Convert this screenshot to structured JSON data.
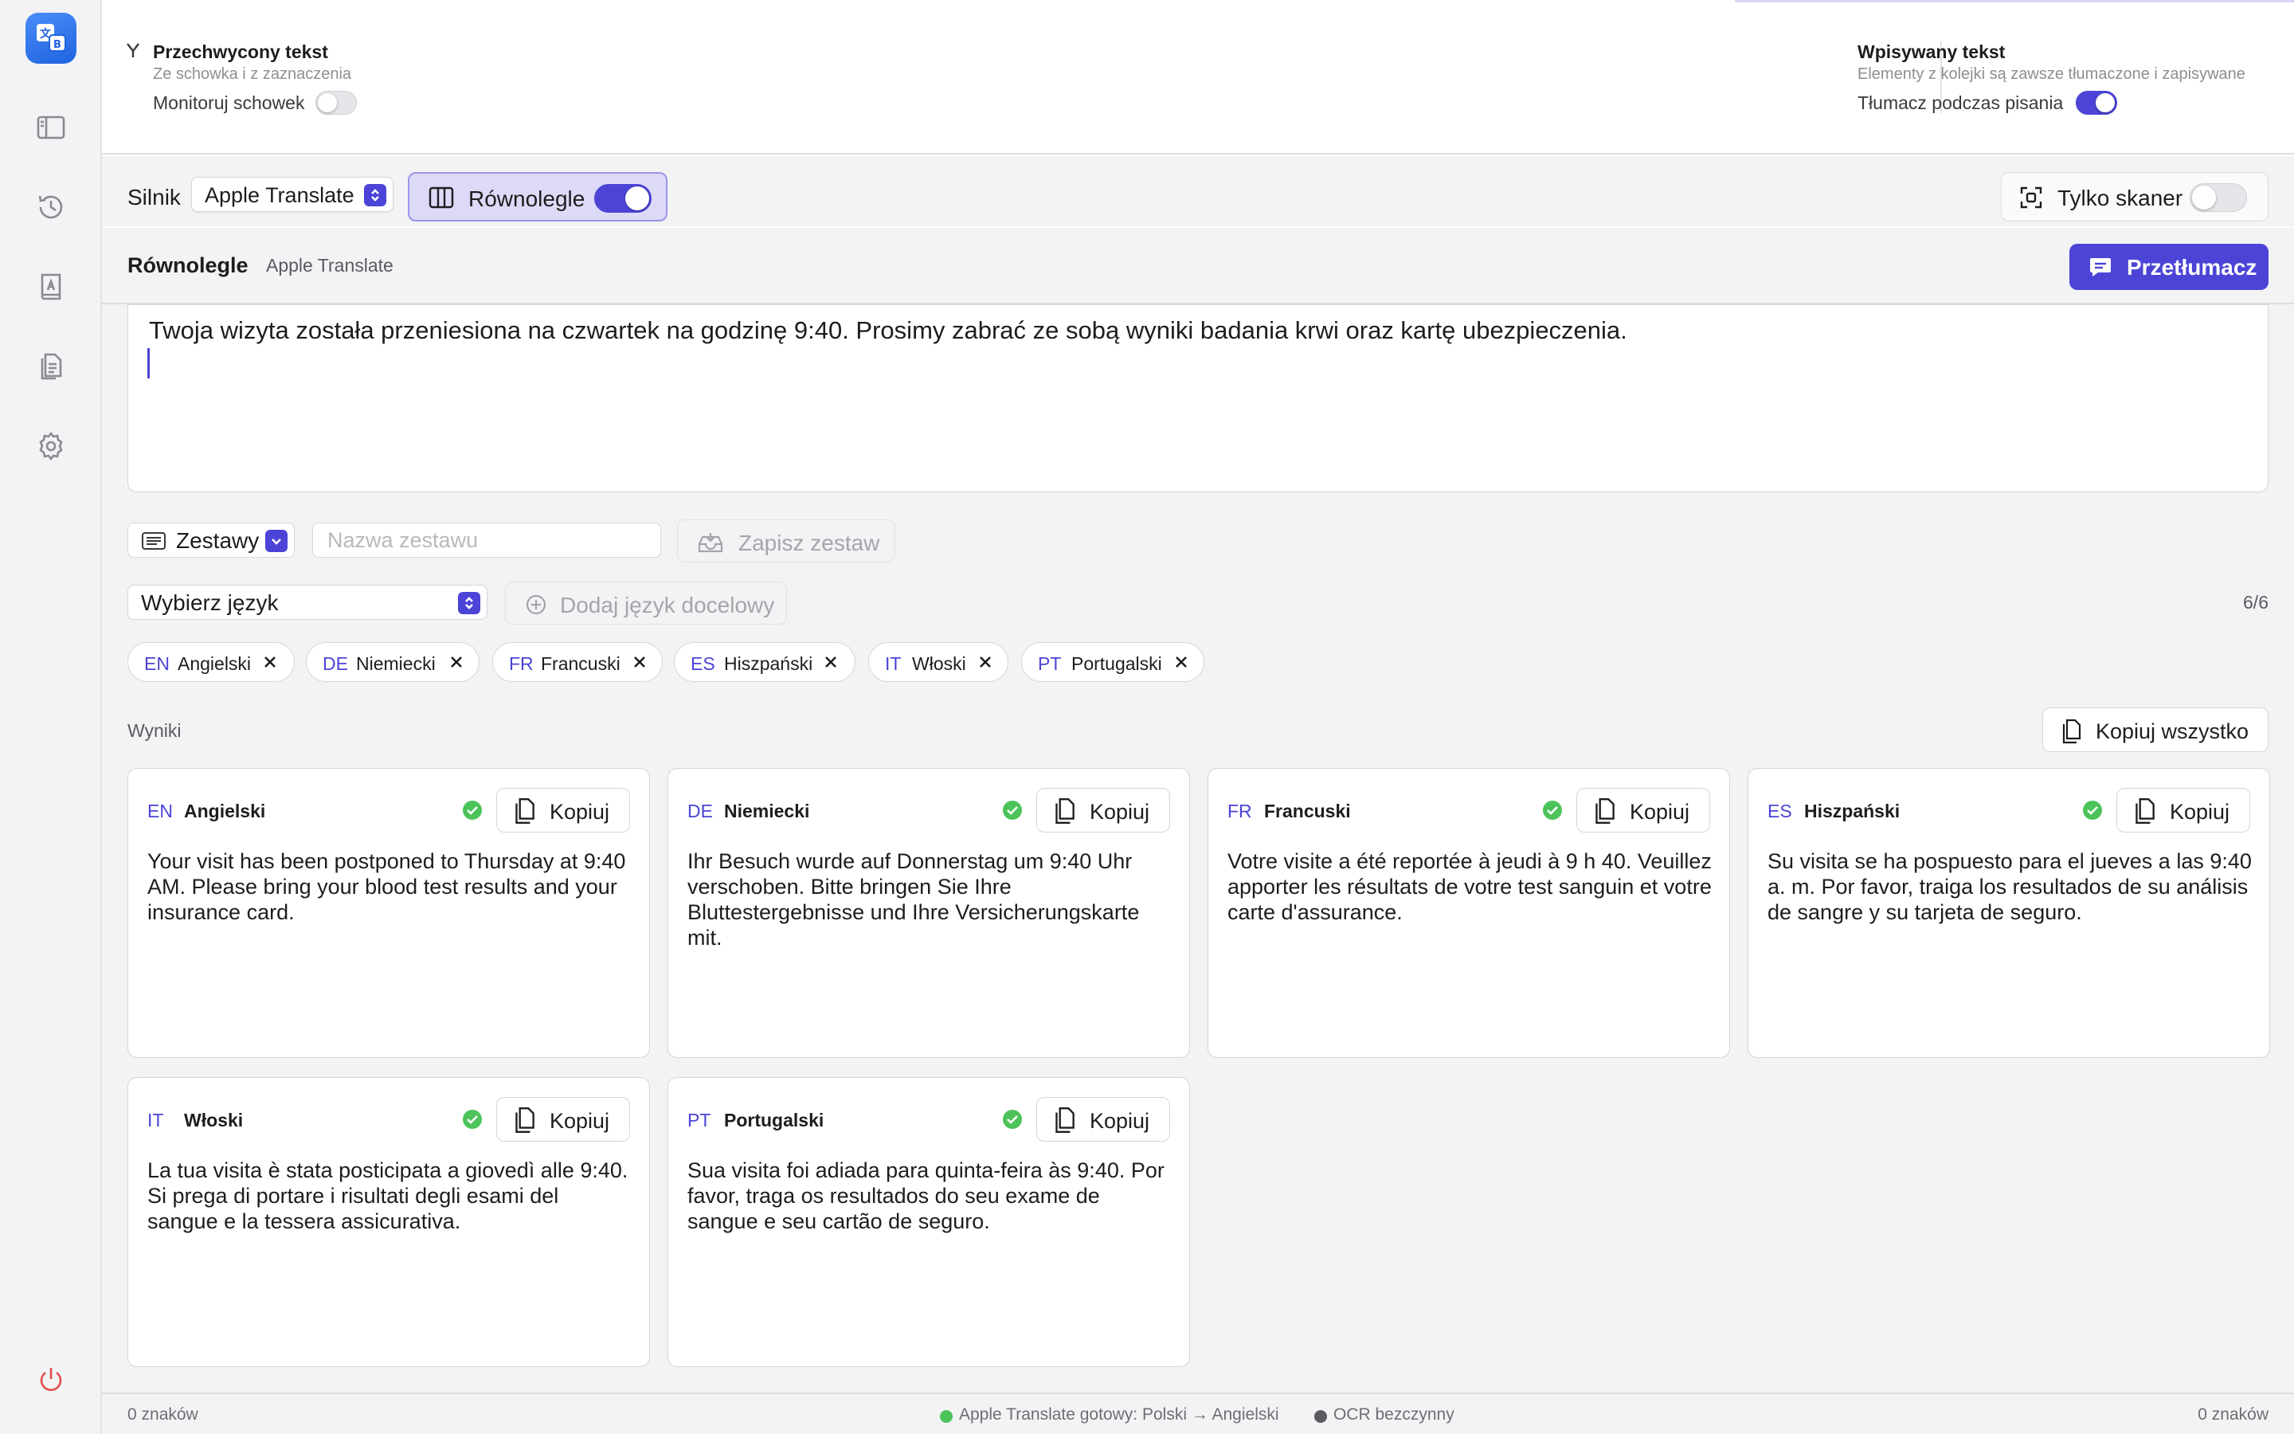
{
  "colors": {
    "accent": "#4b44d6",
    "success": "#4cc35a",
    "power": "#e24b4b"
  },
  "sidebar": {
    "icons": [
      "app-logo-icon",
      "sidebar-toggle-icon",
      "history-icon",
      "dictionary-icon",
      "documents-icon",
      "settings-icon",
      "power-icon"
    ]
  },
  "header": {
    "clipboard": {
      "title": "Przechwycony tekst",
      "subtitle": "Ze schowka i z zaznaczenia",
      "toggle_label": "Monitoruj schowek",
      "toggle_on": false
    },
    "typing": {
      "title": "Wpisywany tekst",
      "subtitle": "Elementy z kolejki są zawsze tłumaczone i zapisywane",
      "toggle_label": "Tłumacz podczas pisania",
      "toggle_on": true
    }
  },
  "toolbar": {
    "engine_label": "Silnik",
    "engine_value": "Apple Translate",
    "parallel_label": "Równolegle",
    "parallel_on": true,
    "scanner_label": "Tylko skaner",
    "scanner_on": false
  },
  "section": {
    "title": "Równolegle",
    "engine": "Apple Translate",
    "translate_label": "Przetłumacz"
  },
  "input": {
    "text": "Twoja wizyta została przeniesiona na czwartek na godzinę 9:40. Prosimy zabrać ze sobą wyniki badania krwi oraz kartę ubezpieczenia."
  },
  "sets": {
    "button_label": "Zestawy",
    "name_placeholder": "Nazwa zestawu",
    "name_value": "",
    "save_label": "Zapisz zestaw"
  },
  "languages": {
    "select_label": "Wybierz język",
    "add_label": "Dodaj język docelowy",
    "count": "6/6",
    "chips": [
      {
        "code": "EN",
        "name": "Angielski"
      },
      {
        "code": "DE",
        "name": "Niemiecki"
      },
      {
        "code": "FR",
        "name": "Francuski"
      },
      {
        "code": "ES",
        "name": "Hiszpański"
      },
      {
        "code": "IT",
        "name": "Włoski"
      },
      {
        "code": "PT",
        "name": "Portugalski"
      }
    ]
  },
  "results": {
    "label": "Wyniki",
    "copy_all_label": "Kopiuj wszystko",
    "copy_label": "Kopiuj",
    "cards": [
      {
        "code": "EN",
        "name": "Angielski",
        "text": "Your visit has been postponed to Thursday at 9:40 AM. Please bring your blood test results and your insurance card."
      },
      {
        "code": "DE",
        "name": "Niemiecki",
        "text": "Ihr Besuch wurde auf Donnerstag um 9:40 Uhr verschoben. Bitte bringen Sie Ihre Bluttestergebnisse und Ihre Versicherungskarte mit."
      },
      {
        "code": "FR",
        "name": "Francuski",
        "text": "Votre visite a été reportée à jeudi à 9 h 40. Veuillez apporter les résultats de votre test sanguin et votre carte d'assurance."
      },
      {
        "code": "ES",
        "name": "Hiszpański",
        "text": "Su visita se ha pospuesto para el jueves a las 9:40 a. m. Por favor, traiga los resultados de su análisis de sangre y su tarjeta de seguro."
      },
      {
        "code": "IT",
        "name": "Włoski",
        "text": "La tua visita è stata posticipata a giovedì alle 9:40. Si prega di portare i risultati degli esami del sangue e la tessera assicurativa."
      },
      {
        "code": "PT",
        "name": "Portugalski",
        "text": "Sua visita foi adiada para quinta-feira às 9:40. Por favor, traga os resultados do seu exame de sangue e seu cartão de seguro."
      }
    ]
  },
  "status": {
    "left_count": "0 znaków",
    "engine_status": "Apple Translate gotowy: Polski → Angielski",
    "ocr_status": "OCR bezczynny",
    "right_count": "0 znaków"
  }
}
